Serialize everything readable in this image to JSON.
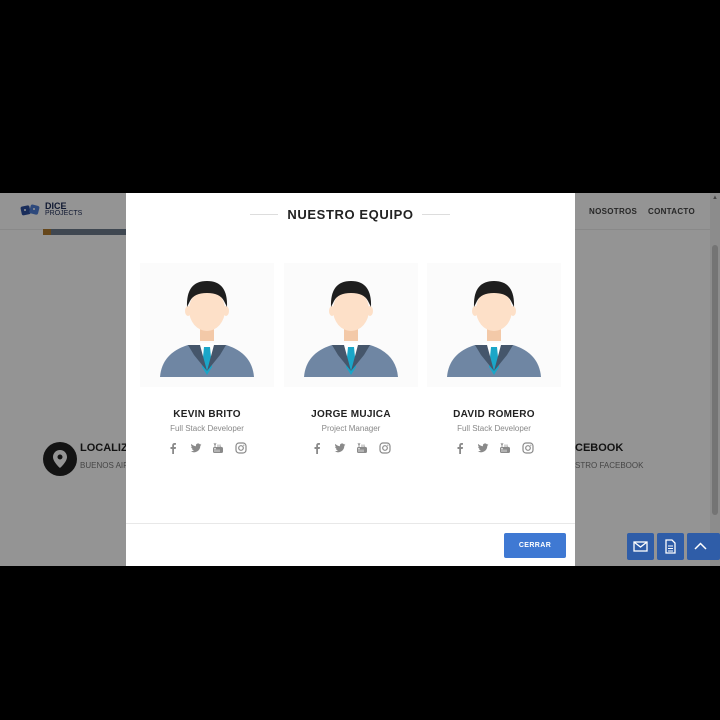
{
  "site": {
    "logo": {
      "title": "DICE",
      "subtitle": "PROJECTS"
    },
    "nav": [
      {
        "label": "NOSOTROS"
      },
      {
        "label": "CONTACTO"
      }
    ],
    "contact": {
      "left_title": "LOCALIZ",
      "left_sub": "BUENOS AIR",
      "right_title": "CEBOOK",
      "right_sub": "STRO FACEBOOK"
    }
  },
  "modal": {
    "title": "NUESTRO EQUIPO",
    "members": [
      {
        "name": "KEVIN BRITO",
        "role": "Full Stack Developer"
      },
      {
        "name": "JORGE MUJICA",
        "role": "Project Manager"
      },
      {
        "name": "DAVID ROMERO",
        "role": "Full Stack Developer"
      }
    ],
    "social_icons": [
      "facebook-icon",
      "twitter-icon",
      "youtube-icon",
      "instagram-icon"
    ],
    "close_label": "CERRAR"
  },
  "floating_buttons": [
    "mail-icon",
    "document-icon",
    "chevron-up-icon"
  ],
  "colors": {
    "accent": "#3f79d3",
    "fab": "#2f5da8",
    "suit": "#6f86a3",
    "tie": "#1aa6c8",
    "hair": "#1e1e1e",
    "skin": "#fde0c8"
  }
}
